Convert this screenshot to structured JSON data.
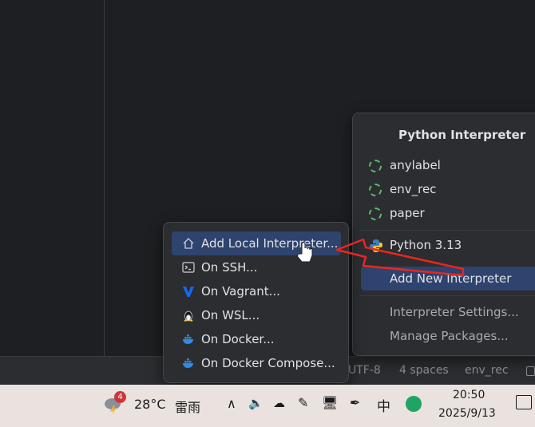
{
  "status_bar": {
    "encoding": "UTF-8",
    "indent": "4 spaces",
    "interpreter": "env_rec"
  },
  "interpreter_popup": {
    "title": "Python Interpreter",
    "envs": [
      "anylabel",
      "env_rec",
      "paper"
    ],
    "python": "Python 3.13",
    "add_new": "Add New Interpreter",
    "settings": "Interpreter Settings...",
    "manage": "Manage Packages..."
  },
  "add_submenu": {
    "items": [
      {
        "label": "Add Local Interpreter...",
        "icon": "home-icon"
      },
      {
        "label": "On SSH...",
        "icon": "terminal-icon"
      },
      {
        "label": "On Vagrant...",
        "icon": "vagrant-icon"
      },
      {
        "label": "On WSL...",
        "icon": "linux-icon"
      },
      {
        "label": "On Docker...",
        "icon": "docker-icon"
      },
      {
        "label": "On Docker Compose...",
        "icon": "docker-icon"
      }
    ]
  },
  "taskbar": {
    "weather_badge": "4",
    "temperature": "28°C",
    "weather_text": "雷雨",
    "ime": "中",
    "time": "20:50",
    "date": "2025/9/13"
  },
  "colors": {
    "accent": "#2e436e",
    "arrow": "#e8261f"
  }
}
